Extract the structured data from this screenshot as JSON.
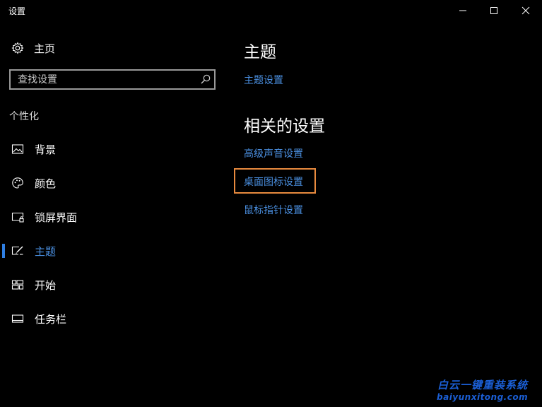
{
  "window": {
    "title": "设置"
  },
  "sidebar": {
    "home_label": "主页",
    "search_placeholder": "查找设置",
    "section_label": "个性化",
    "items": [
      {
        "label": "背景",
        "icon": "picture-icon"
      },
      {
        "label": "颜色",
        "icon": "palette-icon"
      },
      {
        "label": "锁屏界面",
        "icon": "lock-screen-icon"
      },
      {
        "label": "主题",
        "icon": "theme-icon",
        "active": true
      },
      {
        "label": "开始",
        "icon": "start-icon"
      },
      {
        "label": "任务栏",
        "icon": "taskbar-icon"
      }
    ]
  },
  "main": {
    "heading": "主题",
    "theme_settings_link": "主题设置",
    "related_heading": "相关的设置",
    "related_links": [
      "高级声音设置",
      "桌面图标设置",
      "鼠标指针设置"
    ]
  },
  "watermark": {
    "line1": "白云一键重装系统",
    "line2": "baiyunxitong.com"
  },
  "colors": {
    "background": "#000000",
    "accent": "#2f7fe3",
    "link": "#4a8fe0",
    "highlight": "#e88a3e"
  }
}
